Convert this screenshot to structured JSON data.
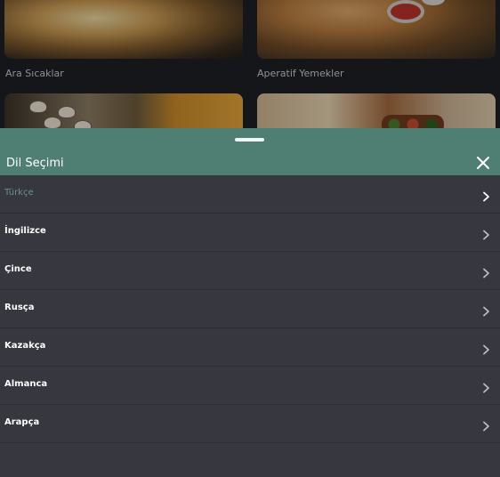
{
  "background": {
    "categories": [
      {
        "label": "Ara Sıcaklar"
      },
      {
        "label": "Aperatif Yemekler"
      }
    ]
  },
  "sheet": {
    "title": "Dil Seçimi",
    "header_color": "#4f7f73",
    "active_color": "#6c9185",
    "languages": [
      {
        "label": "Türkçe",
        "selected": true
      },
      {
        "label": "İngilizce",
        "selected": false
      },
      {
        "label": "Çince",
        "selected": false
      },
      {
        "label": "Rusça",
        "selected": false
      },
      {
        "label": "Kazakça",
        "selected": false
      },
      {
        "label": "Almanca",
        "selected": false
      },
      {
        "label": "Arapça",
        "selected": false
      }
    ]
  },
  "icons": {
    "close": "close-icon",
    "row_arrow": "chevron-right-icon"
  }
}
